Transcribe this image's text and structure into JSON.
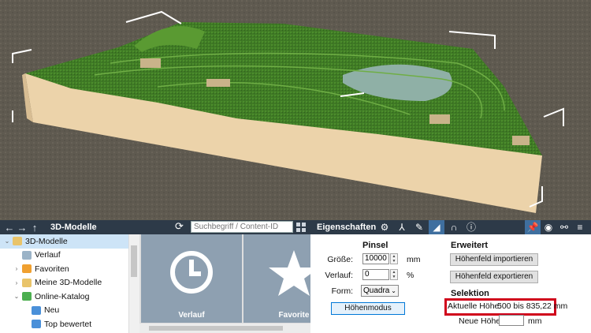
{
  "viewport": {
    "colors": {
      "ground": "#5f5a50",
      "terrain": "#3f7a25",
      "base": "#ecd3aa",
      "water": "#8fb0a6",
      "frame": "#ffffff"
    }
  },
  "left_toolbar": {
    "back_icon": "arrow-left-icon",
    "forward_icon": "arrow-right-icon",
    "up_icon": "arrow-up-icon",
    "title": "3D-Modelle",
    "refresh_icon": "refresh-icon",
    "search_placeholder": "Suchbegriff / Content-ID",
    "grid_icon": "grid-view-icon"
  },
  "right_toolbar": {
    "title": "Eigenschaften",
    "tool_icons": [
      "gear-icon",
      "move-axes-icon",
      "paint-brush-icon",
      "terrain-icon",
      "tunnel-icon",
      "info-icon"
    ],
    "active_tool": "terrain-icon",
    "right_icons": [
      "pin-icon",
      "eye-icon",
      "link-icon",
      "menu-icon"
    ]
  },
  "tree": {
    "items": [
      {
        "label": "3D-Modelle",
        "arrow": "v",
        "icon": "folder-icon",
        "color": "#e9c46a",
        "selected": true,
        "indent": 0
      },
      {
        "label": "Verlauf",
        "arrow": "",
        "icon": "clock-icon",
        "color": "#9bb3c7",
        "selected": false,
        "indent": 1
      },
      {
        "label": "Favoriten",
        "arrow": ">",
        "icon": "star-folder-icon",
        "color": "#f0a030",
        "selected": false,
        "indent": 1
      },
      {
        "label": "Meine 3D-Modelle",
        "arrow": ">",
        "icon": "folder-icon",
        "color": "#e9c46a",
        "selected": false,
        "indent": 1
      },
      {
        "label": "Online-Katalog",
        "arrow": "v",
        "icon": "globe-icon",
        "color": "#4caf50",
        "selected": false,
        "indent": 1
      },
      {
        "label": "Neu",
        "arrow": "",
        "icon": "new-badge-icon",
        "color": "#4a90d9",
        "selected": false,
        "indent": 2
      },
      {
        "label": "Top bewertet",
        "arrow": "",
        "icon": "top-rated-icon",
        "color": "#4a90d9",
        "selected": false,
        "indent": 2
      }
    ]
  },
  "tiles": [
    {
      "label": "Verlauf",
      "icon": "clock-icon"
    },
    {
      "label": "Favorite",
      "icon": "star-icon"
    }
  ],
  "pinsel": {
    "heading": "Pinsel",
    "size_label": "Größe:",
    "size_value": "10000",
    "size_unit": "mm",
    "gradient_label": "Verlauf:",
    "gradient_value": "0",
    "gradient_unit": "%",
    "shape_label": "Form:",
    "shape_value": "Quadra",
    "mode_button": "Höhenmodus"
  },
  "erweitert": {
    "heading": "Erweitert",
    "import_button": "Höhenfeld importieren",
    "export_button": "Höhenfeld exportieren"
  },
  "selektion": {
    "heading": "Selektion",
    "current_height_label": "Aktuelle Höhe:",
    "current_height_value": "500 bis 835,22 mm",
    "new_height_label": "Neue Höhe:",
    "new_height_value": "",
    "new_height_unit": "mm"
  }
}
